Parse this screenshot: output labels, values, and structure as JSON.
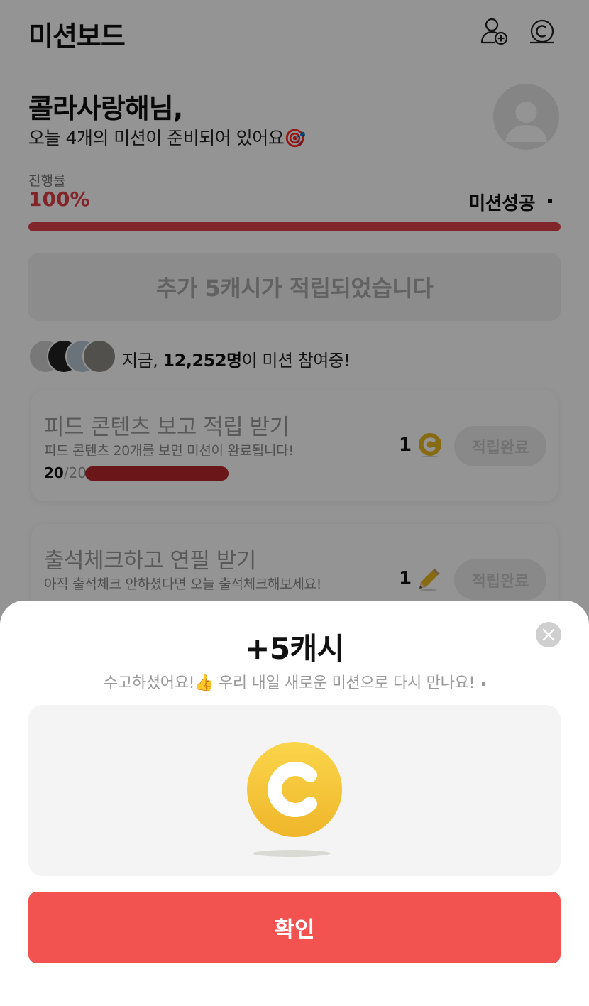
{
  "header": {
    "title": "미션보드",
    "friend_icon": "add-friend-icon",
    "cash_icon": "cash-coin-icon"
  },
  "greeting": {
    "name": "콜라사랑해님,",
    "subtitle": "오늘 4개의 미션이 준비되어 있어요🎯"
  },
  "progress": {
    "label": "진행률",
    "value": "100%",
    "percent": 100,
    "status": "미션성공",
    "color": "#e0404a"
  },
  "banner": {
    "text": "추가 5캐시가 적립되었습니다"
  },
  "participants": {
    "prefix": "지금, ",
    "count": "12,252명",
    "suffix": "이 미션 참여중!"
  },
  "missions": [
    {
      "title": "피드 콘텐츠 보고 적립 받기",
      "description": "피드 콘텐츠 20개를 보면 미션이 완료됩니다!",
      "progress_done": "20",
      "progress_total": "/20",
      "progress_fraction": 1.0,
      "reward_amount": "1",
      "reward_icon": "cash-coin-icon",
      "button_label": "적립완료"
    },
    {
      "title": "출석체크하고 연필 받기",
      "description": "아직 출석체크 안하셨다면 오늘 출석체크해보세요!",
      "reward_amount": "1",
      "reward_icon": "pencil-icon",
      "button_label": "적립완료"
    }
  ],
  "sheet": {
    "title": "+5캐시",
    "subtitle": "수고하셨어요!👍 우리 내일 새로운 미션으로 다시 만나요!",
    "close_icon": "close-icon",
    "reward_icon": "cash-coin-icon",
    "confirm_label": "확인",
    "confirm_color": "#f35350"
  }
}
